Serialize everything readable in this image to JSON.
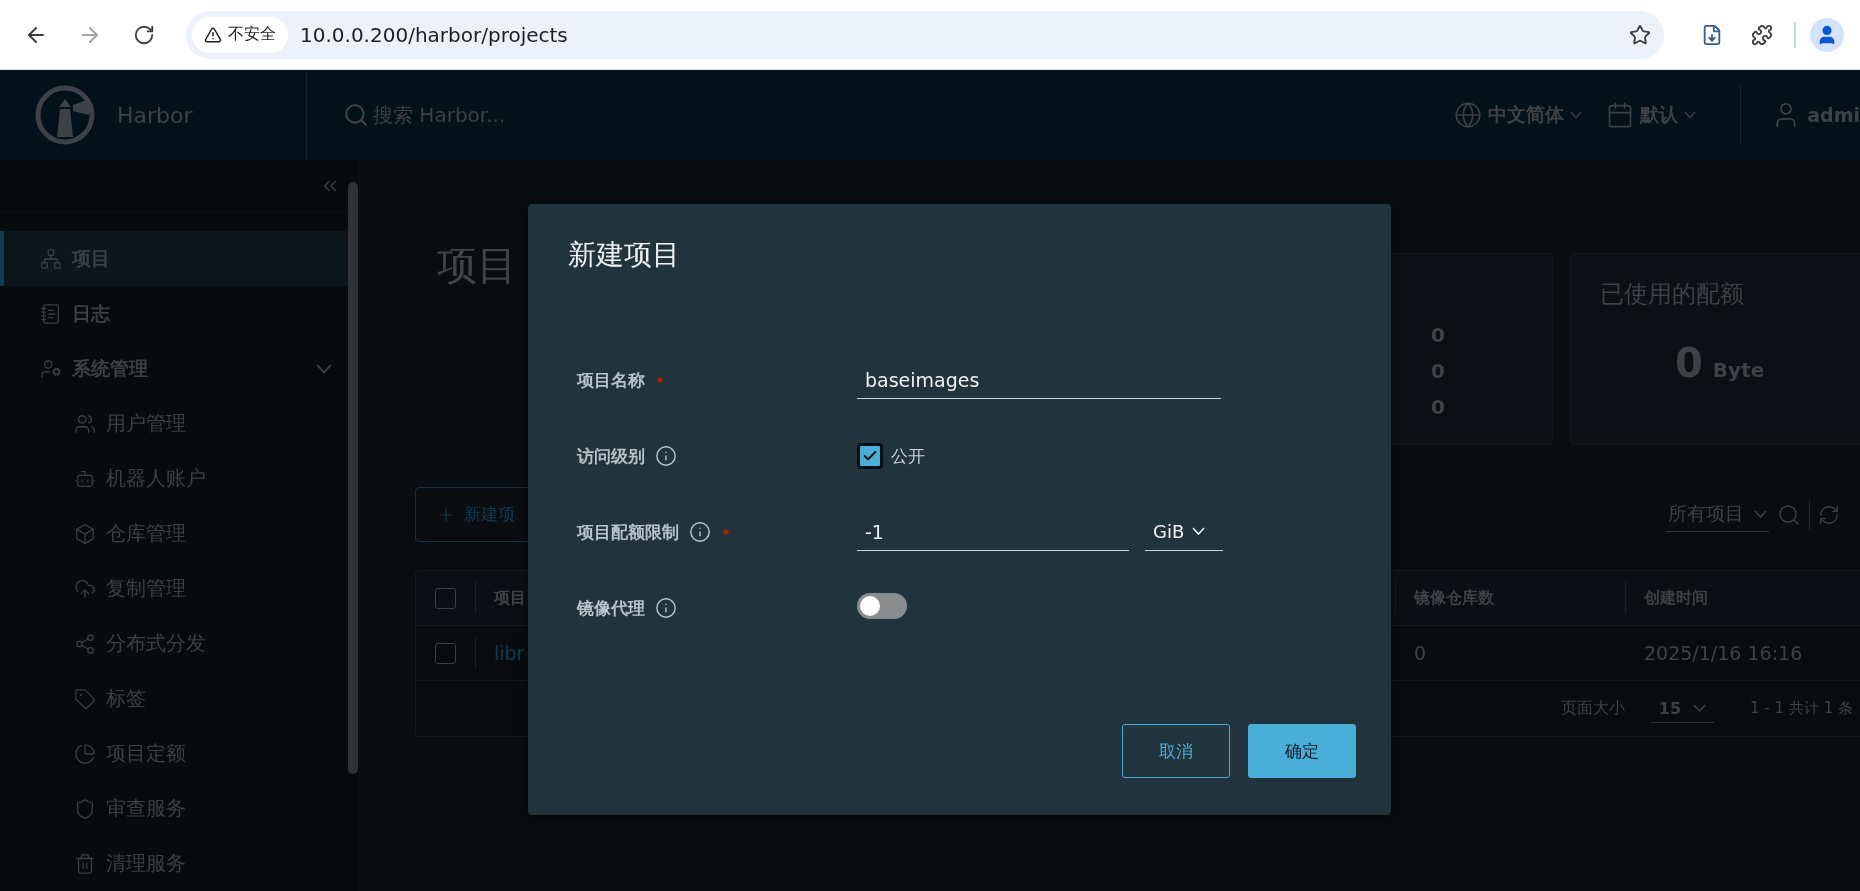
{
  "browser": {
    "security_label": "不安全",
    "url": "10.0.0.200/harbor/projects"
  },
  "header": {
    "brand": "Harbor",
    "search_placeholder": "搜索 Harbor...",
    "language": "中文简体",
    "theme": "默认",
    "user": "admi"
  },
  "sidebar": {
    "items": [
      {
        "label": "项目",
        "selected": true
      },
      {
        "label": "日志",
        "selected": false
      },
      {
        "label": "系统管理",
        "selected": false,
        "expanded": true,
        "children": [
          {
            "label": "用户管理",
            "selected": false
          },
          {
            "label": "机器人账户",
            "selected": false
          },
          {
            "label": "仓库管理",
            "selected": false
          },
          {
            "label": "复制管理",
            "selected": false
          },
          {
            "label": "分布式分发",
            "selected": false
          },
          {
            "label": "标签",
            "selected": false
          },
          {
            "label": "项目定额",
            "selected": false
          },
          {
            "label": "审查服务",
            "selected": false
          },
          {
            "label": "清理服务",
            "selected": false
          }
        ]
      }
    ]
  },
  "page": {
    "title": "项目",
    "stats": [
      "0",
      "0",
      "0"
    ],
    "quota": {
      "title": "已使用的配额",
      "value": "0",
      "unit": "Byte"
    },
    "new_button": "新建项",
    "filter": "所有项目",
    "table": {
      "header_checked": false,
      "columns": [
        "项目",
        "镜像仓库数",
        "创建时间"
      ],
      "rows": [
        {
          "selected": false,
          "cells": [
            "libr",
            "0",
            "2025/1/16 16:16"
          ]
        }
      ]
    },
    "footer": {
      "page_size_label": "页面大小",
      "page_size": "15",
      "range": "1 - 1 共计 1 条"
    }
  },
  "dialog": {
    "title": "新建项目",
    "fields": [
      {
        "kind": "text",
        "label": "项目名称",
        "info": false,
        "required": true,
        "value": "baseimages"
      },
      {
        "kind": "checkbox",
        "label": "访问级别",
        "info": true,
        "required": false,
        "checked": true,
        "option": "公开"
      },
      {
        "kind": "quota",
        "label": "项目配额限制",
        "info": true,
        "required": true,
        "value": "-1",
        "unit": "GiB"
      },
      {
        "kind": "toggle",
        "label": "镜像代理",
        "info": true,
        "required": false,
        "on": false
      }
    ],
    "buttons": [
      {
        "label": "取消",
        "primary": false
      },
      {
        "label": "确定",
        "primary": true
      }
    ]
  }
}
